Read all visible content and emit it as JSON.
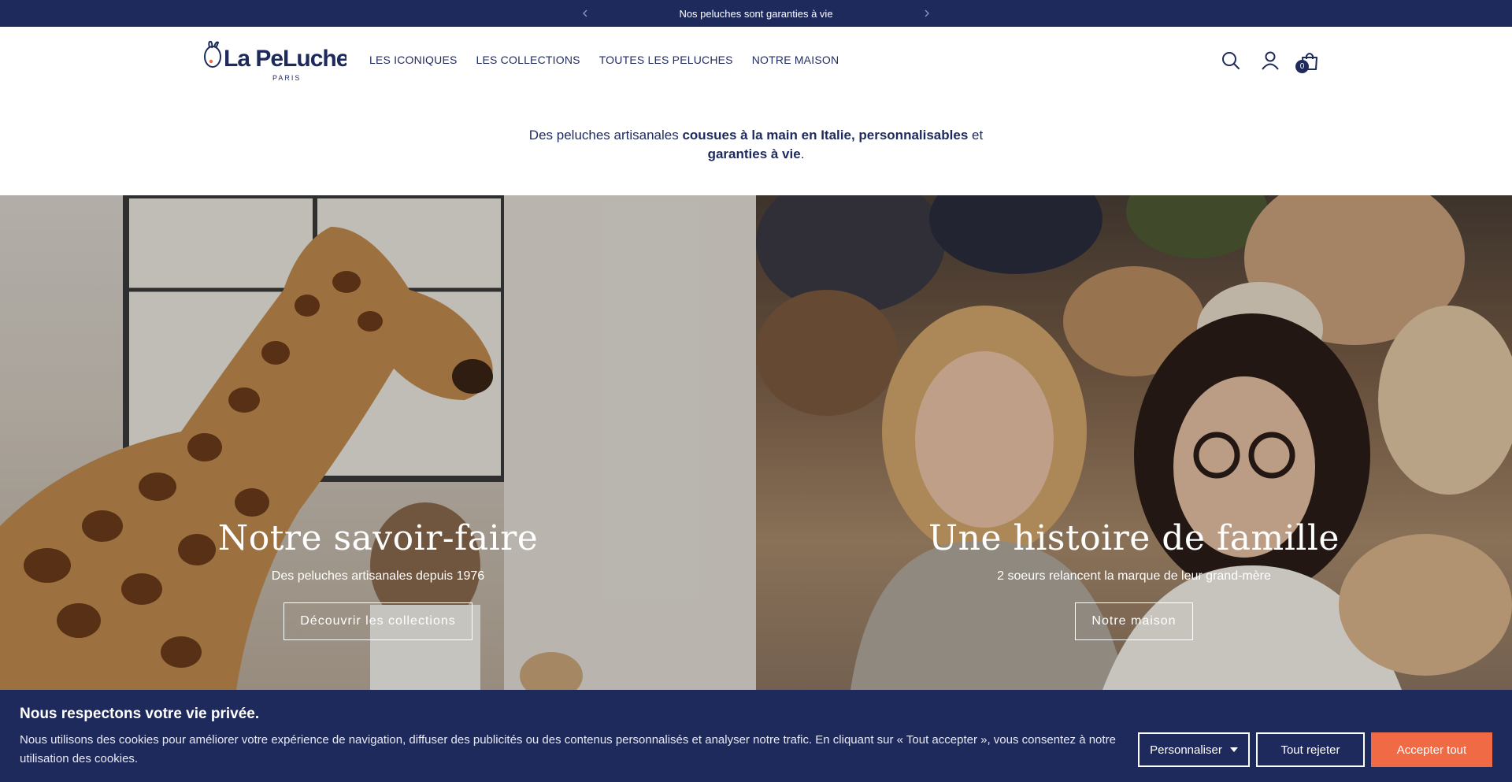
{
  "announcement": {
    "text": "Nos peluches sont garanties à vie",
    "prev_icon": "chevron-left-icon",
    "next_icon": "chevron-right-icon"
  },
  "header": {
    "logo_text": "La Pelucherie",
    "logo_sub": "PARIS",
    "nav": [
      {
        "label": "LES ICONIQUES"
      },
      {
        "label": "LES COLLECTIONS"
      },
      {
        "label": "TOUTES LES PELUCHES"
      },
      {
        "label": "NOTRE MAISON"
      }
    ],
    "icons": {
      "search": "search-icon",
      "account": "account-icon",
      "cart": "cart-icon"
    },
    "cart_count": "0"
  },
  "intro": {
    "part1": "Des peluches artisanales ",
    "bold1": "cousues à la main en Italie, personnalisables",
    "part2": " et",
    "bold2": "garanties à vie",
    "part3": "."
  },
  "hero": {
    "left": {
      "title": "Notre savoir-faire",
      "subtitle": "Des peluches artisanales depuis 1976",
      "button": "Découvrir les collections"
    },
    "right": {
      "title": "Une histoire de famille",
      "subtitle": "2 soeurs relancent la marque de leur grand-mère",
      "button": "Notre maison"
    }
  },
  "cookie": {
    "title": "Nous respectons votre vie privée.",
    "text": "Nous utilisons des cookies pour améliorer votre expérience de navigation, diffuser des publicités ou des contenus personnalisés et analyser notre trafic. En cliquant sur « Tout accepter », vous consentez à notre utilisation des cookies.",
    "customize": "Personnaliser",
    "reject": "Tout rejeter",
    "accept": "Accepter tout"
  },
  "colors": {
    "navy": "#1f2a5c",
    "accent": "#ef6a45",
    "white": "#ffffff"
  }
}
